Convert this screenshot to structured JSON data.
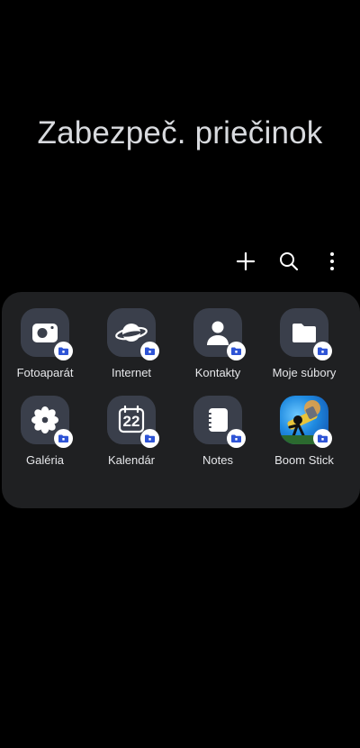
{
  "header": {
    "title": "Zabezpeč. priečinok"
  },
  "toolbar": {
    "actions": [
      {
        "name": "add",
        "icon": "plus-icon"
      },
      {
        "name": "search",
        "icon": "search-icon"
      },
      {
        "name": "more",
        "icon": "more-vertical-icon"
      }
    ]
  },
  "apps": [
    {
      "label": "Fotoaparát",
      "icon": "camera-icon"
    },
    {
      "label": "Internet",
      "icon": "planet-icon"
    },
    {
      "label": "Kontakty",
      "icon": "person-icon"
    },
    {
      "label": "Moje súbory",
      "icon": "folder-icon"
    },
    {
      "label": "Galéria",
      "icon": "flower-icon"
    },
    {
      "label": "Kalendár",
      "icon": "calendar-icon",
      "day": "22"
    },
    {
      "label": "Notes",
      "icon": "notes-icon"
    },
    {
      "label": "Boom Stick",
      "icon": "boom-stick-game-icon"
    }
  ],
  "badge_icon": "secure-folder-badge-icon",
  "colors": {
    "background": "#000000",
    "panel": "#1f2022",
    "icon_bg": "#3a3f4b",
    "badge_blue": "#2e54d6"
  }
}
